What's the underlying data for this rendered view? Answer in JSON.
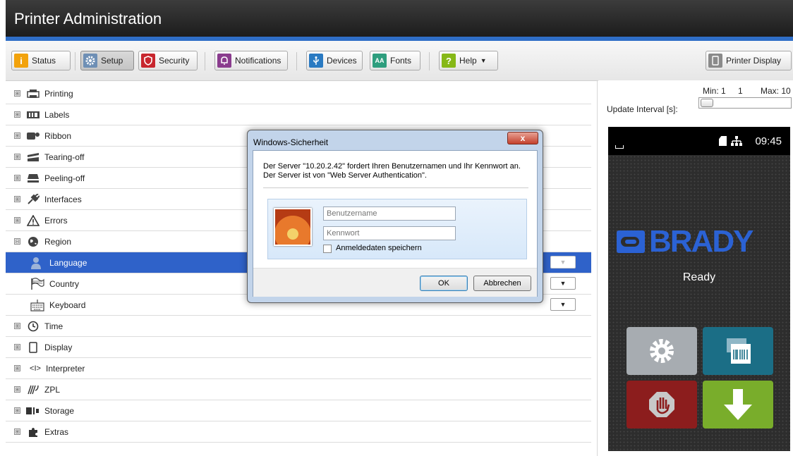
{
  "app": {
    "title": "Printer Administration"
  },
  "toolbar": {
    "buttons": [
      {
        "label": "Status",
        "icon": "info-icon",
        "color": "#f2a20c"
      },
      {
        "label": "Setup",
        "icon": "gear-icon",
        "color": "#6e8fb5",
        "active": true
      },
      {
        "label": "Security",
        "icon": "shield-icon",
        "color": "#c8262e"
      },
      {
        "label": "Notifications",
        "icon": "bell-icon",
        "color": "#8a3c8e"
      },
      {
        "label": "Devices",
        "icon": "usb-icon",
        "color": "#2a7ac2"
      },
      {
        "label": "Fonts",
        "icon": "font-icon",
        "color": "#2e9e7e"
      },
      {
        "label": "Help",
        "icon": "help-icon",
        "color": "#86b817"
      }
    ],
    "printer_display_label": "Printer Display"
  },
  "tree": {
    "items": [
      {
        "label": "Printing",
        "icon": "printer-icon",
        "expander": "⊞"
      },
      {
        "label": "Labels",
        "icon": "labels-icon",
        "expander": "⊞"
      },
      {
        "label": "Ribbon",
        "icon": "ribbon-icon",
        "expander": "⊞"
      },
      {
        "label": "Tearing-off",
        "icon": "tear-off-icon",
        "expander": "⊞"
      },
      {
        "label": "Peeling-off",
        "icon": "peel-off-icon",
        "expander": "⊞"
      },
      {
        "label": "Interfaces",
        "icon": "plug-icon",
        "expander": "⊞"
      },
      {
        "label": "Errors",
        "icon": "warning-icon",
        "expander": "⊞"
      },
      {
        "label": "Region",
        "icon": "globe-icon",
        "expander": "⊟"
      },
      {
        "label": "Language",
        "icon": "language-icon",
        "sub": true,
        "selected": true
      },
      {
        "label": "Country",
        "icon": "flag-icon",
        "sub": true
      },
      {
        "label": "Keyboard",
        "icon": "keyboard-icon",
        "sub": true
      },
      {
        "label": "Time",
        "icon": "clock-icon",
        "expander": "⊞"
      },
      {
        "label": "Display",
        "icon": "display-icon",
        "expander": "⊞"
      },
      {
        "label": "Interpreter",
        "icon": "interpreter-icon",
        "expander": "⊞"
      },
      {
        "label": "ZPL",
        "icon": "zpl-icon",
        "expander": "⊞"
      },
      {
        "label": "Storage",
        "icon": "storage-icon",
        "expander": "⊞"
      },
      {
        "label": "Extras",
        "icon": "puzzle-icon",
        "expander": "⊞"
      }
    ]
  },
  "update_interval": {
    "label": "Update Interval [s]:",
    "min_label": "Min: 1",
    "value": "1",
    "max_label": "Max: 10"
  },
  "printer_display": {
    "time": "09:45",
    "brand": "BRADY",
    "status": "Ready"
  },
  "dialog": {
    "title": "Windows-Sicherheit",
    "close_label": "x",
    "message_line1": "Der Server \"10.20.2.42\" fordert Ihren Benutzernamen und Ihr Kennwort an.",
    "message_line2": "Der Server ist von \"Web Server Authentication\".",
    "username_placeholder": "Benutzername",
    "password_placeholder": "Kennwort",
    "remember_label": "Anmeldedaten speichern",
    "ok_label": "OK",
    "cancel_label": "Abbrechen"
  },
  "colors": {
    "selection": "#2f62c9",
    "accent_blue": "#2f6ec7",
    "brand_blue": "#2b62d4"
  }
}
